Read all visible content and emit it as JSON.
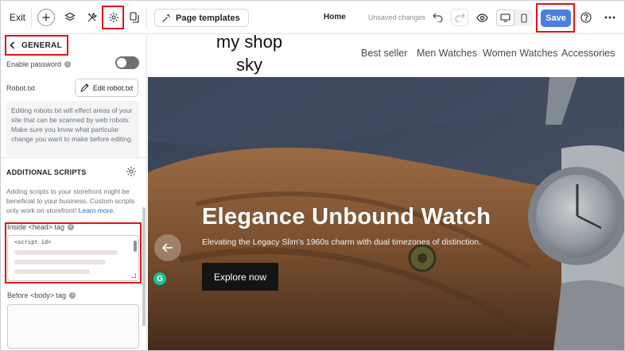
{
  "topbar": {
    "exit_label": "Exit",
    "page_templates_label": "Page templates",
    "current_page": "Home",
    "save_status": "Unsaved changes",
    "save_label": "Save"
  },
  "sidebar": {
    "back_label": "GENERAL",
    "enable_password_label": "Enable password",
    "enable_password_on": false,
    "robots_label": "Robot.txt",
    "edit_robots_label": "Edit robot.txt",
    "robots_note": "Editing robots.txt will effect areas of your site that can be scanned by web robots. Make sure you know what particular change you want to make before editing.",
    "scripts_title": "ADDITIONAL SCRIPTS",
    "scripts_desc": "Adding scripts to your storefront might be beneficial to your business. Custom scripts only work on storefront!",
    "learn_more": "Learn more.",
    "head_tag_label": "Inside <head> tag",
    "head_tag_value": "<script id=",
    "body_tag_label": "Before <body> tag",
    "body_tag_value": ""
  },
  "preview": {
    "logo_line1": "my shop",
    "logo_line2": "sky",
    "nav": [
      "Best seller",
      "Men Watches",
      "Women Watches",
      "Accessories"
    ],
    "hero_title": "Elegance Unbound Watch",
    "hero_subtitle": "Elevating the Legacy Slim's 1960s charm with dual timezones of distinction.",
    "hero_cta": "Explore now",
    "grammarly_letter": "G"
  },
  "colors": {
    "accent": "#4a7ee0",
    "highlight": "#e0131b",
    "link": "#2c6ecb"
  }
}
